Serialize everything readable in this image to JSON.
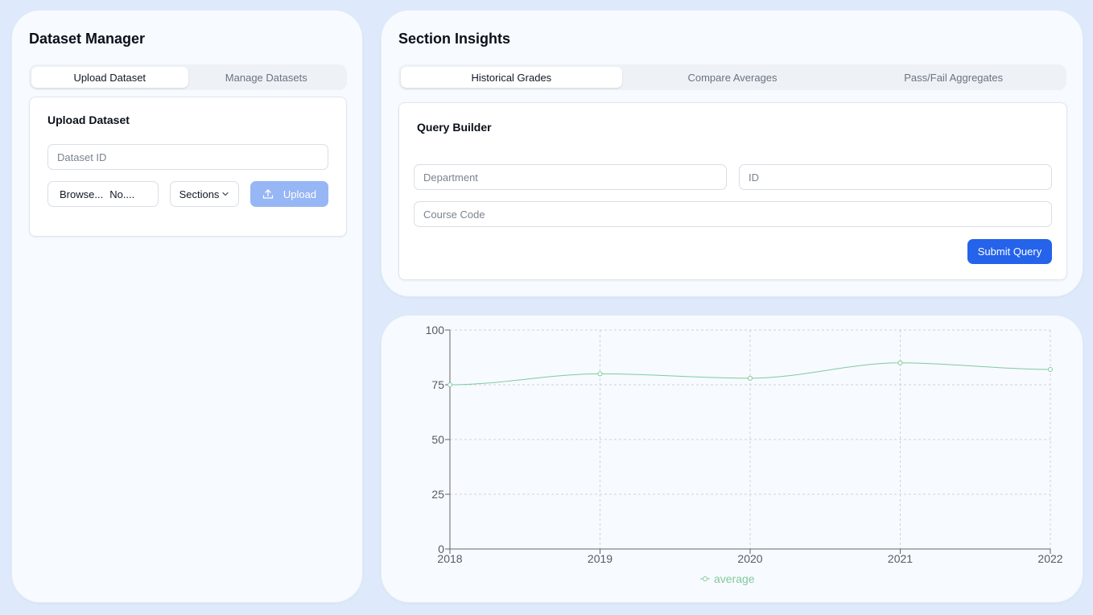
{
  "left_panel": {
    "title": "Dataset Manager",
    "tabs": [
      {
        "label": "Upload Dataset",
        "active": true
      },
      {
        "label": "Manage Datasets",
        "active": false
      }
    ],
    "upload_card": {
      "title": "Upload Dataset",
      "dataset_id_placeholder": "Dataset ID",
      "dataset_id_value": "",
      "file_browse_label": "Browse...",
      "file_name": "No....",
      "kind_select_value": "Sections",
      "upload_label": "Upload",
      "upload_icon": "upload-icon"
    }
  },
  "right_panel": {
    "title": "Section Insights",
    "tabs": [
      {
        "label": "Historical Grades",
        "active": true
      },
      {
        "label": "Compare Averages",
        "active": false
      },
      {
        "label": "Pass/Fail Aggregates",
        "active": false
      }
    ],
    "query_card": {
      "title": "Query Builder",
      "department_placeholder": "Department",
      "id_placeholder": "ID",
      "course_code_placeholder": "Course Code",
      "submit_label": "Submit Query"
    }
  },
  "colors": {
    "page_background": "#deeafb",
    "primary_button": "#2563eb",
    "disabled_button": "#97b6f5",
    "series_line": "#82ca9d"
  },
  "chart_data": {
    "type": "line",
    "categories": [
      "2018",
      "2019",
      "2020",
      "2021",
      "2022"
    ],
    "series": [
      {
        "name": "average",
        "values": [
          75,
          80,
          78,
          85,
          82
        ],
        "color": "#82ca9d"
      }
    ],
    "yticks": [
      0,
      25,
      50,
      75,
      100
    ],
    "ylim": [
      0,
      100
    ],
    "grid": true,
    "legend_position": "bottom"
  }
}
